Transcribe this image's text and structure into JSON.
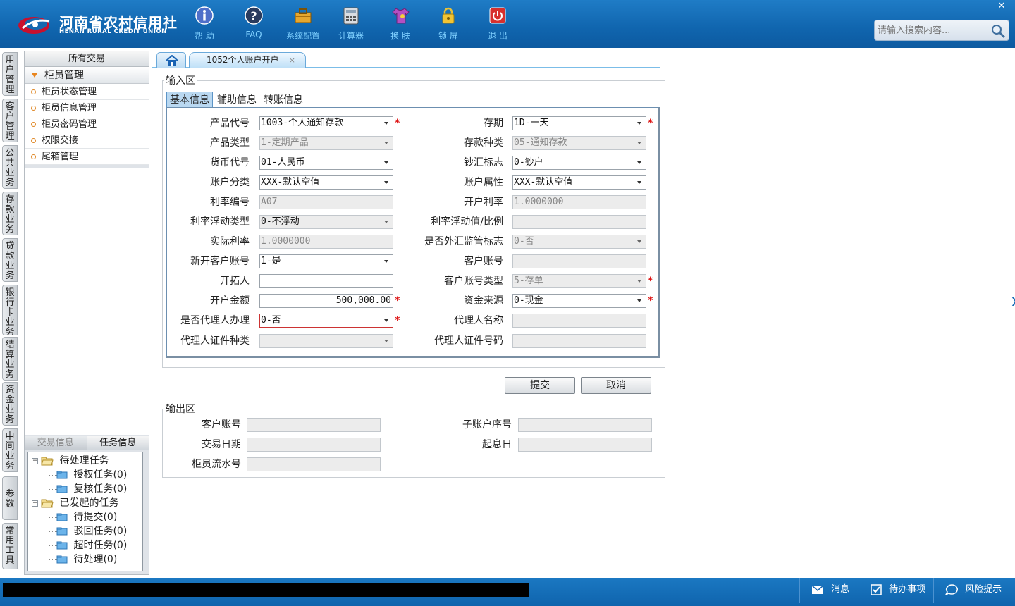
{
  "header": {
    "logo_cn": "河南省农村信用社",
    "logo_en": "HENAN RURAL CREDIT UNION",
    "tools": [
      {
        "label": "帮 助",
        "icon": "info-icon"
      },
      {
        "label": "FAQ",
        "icon": "question-icon"
      },
      {
        "label": "系统配置",
        "icon": "toolbox-icon"
      },
      {
        "label": "计算器",
        "icon": "calculator-icon"
      },
      {
        "label": "换 肤",
        "icon": "shirt-icon"
      },
      {
        "label": "锁 屏",
        "icon": "lock-icon"
      },
      {
        "label": "退 出",
        "icon": "power-icon"
      }
    ],
    "window_controls": {
      "minimize": "—",
      "close": "✕"
    },
    "search_placeholder": "请输入搜索内容..."
  },
  "vnav": [
    "用户管理",
    "客户管理",
    "公共业务",
    "存款业务",
    "贷款业务",
    "银行卡业务",
    "结算业务",
    "资金业务",
    "中间业务",
    "参数",
    "常用工具"
  ],
  "left_panel": {
    "header": "所有交易",
    "group": "柜员管理",
    "items": [
      "柜员状态管理",
      "柜员信息管理",
      "柜员密码管理",
      "权限交接",
      "尾箱管理"
    ],
    "task_tabs": [
      "交易信息",
      "任务信息"
    ],
    "tree": {
      "pending": {
        "label": "待处理任务",
        "children": [
          "授权任务(0)",
          "复核任务(0)"
        ]
      },
      "initiated": {
        "label": "已发起的任务",
        "children": [
          "待提交(0)",
          "驳回任务(0)",
          "超时任务(0)",
          "待处理(0)"
        ]
      }
    }
  },
  "tabs": {
    "active": "1052个人账户开户",
    "close": "×"
  },
  "input_area": {
    "legend": "输入区",
    "subtabs": [
      "基本信息",
      "辅助信息",
      "转账信息"
    ],
    "left_labels": [
      "产品代号",
      "产品类型",
      "货币代号",
      "账户分类",
      "利率编号",
      "利率浮动类型",
      "实际利率",
      "新开客户账号",
      "开拓人",
      "开户金额",
      "是否代理人办理",
      "代理人证件种类"
    ],
    "left_values": [
      "1003-个人通知存款",
      "1-定期产品",
      "01-人民币",
      "XXX-默认空值",
      "A07",
      "0-不浮动",
      "1.0000000",
      "1-是",
      "",
      "500,000.00",
      "0-否",
      ""
    ],
    "right_labels": [
      "存期",
      "存款种类",
      "钞汇标志",
      "账户属性",
      "开户利率",
      "利率浮动值/比例",
      "是否外汇监管标志",
      "客户账号",
      "客户账号类型",
      "资金来源",
      "代理人名称",
      "代理人证件号码"
    ],
    "right_values": [
      "1D-一天",
      "05-通知存款",
      "0-钞户",
      "XXX-默认空值",
      "1.0000000",
      "",
      "0-否",
      "",
      "5-存单",
      "0-现金",
      "",
      ""
    ],
    "required_mark": "*"
  },
  "buttons": {
    "submit": "提交",
    "cancel": "取消"
  },
  "output_area": {
    "legend": "输出区",
    "left_labels": [
      "客户账号",
      "交易日期",
      "柜员流水号"
    ],
    "right_labels": [
      "子账户序号",
      "起息日"
    ]
  },
  "statusbar": {
    "message": "消息",
    "todo": "待办事项",
    "risk": "风险提示"
  }
}
